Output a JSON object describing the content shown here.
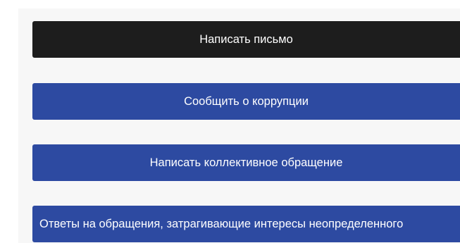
{
  "buttons": {
    "write_letter": "Написать письмо",
    "report_corruption": "Сообщить о коррупции",
    "collective_appeal": "Написать коллективное обращение",
    "answers_to_appeals": "Ответы на обращения, затрагивающие интересы неопределенного"
  },
  "colors": {
    "dark_button": "#1d1d1d",
    "blue_button": "#2d4aa1",
    "panel_background": "#f7f7f7"
  }
}
